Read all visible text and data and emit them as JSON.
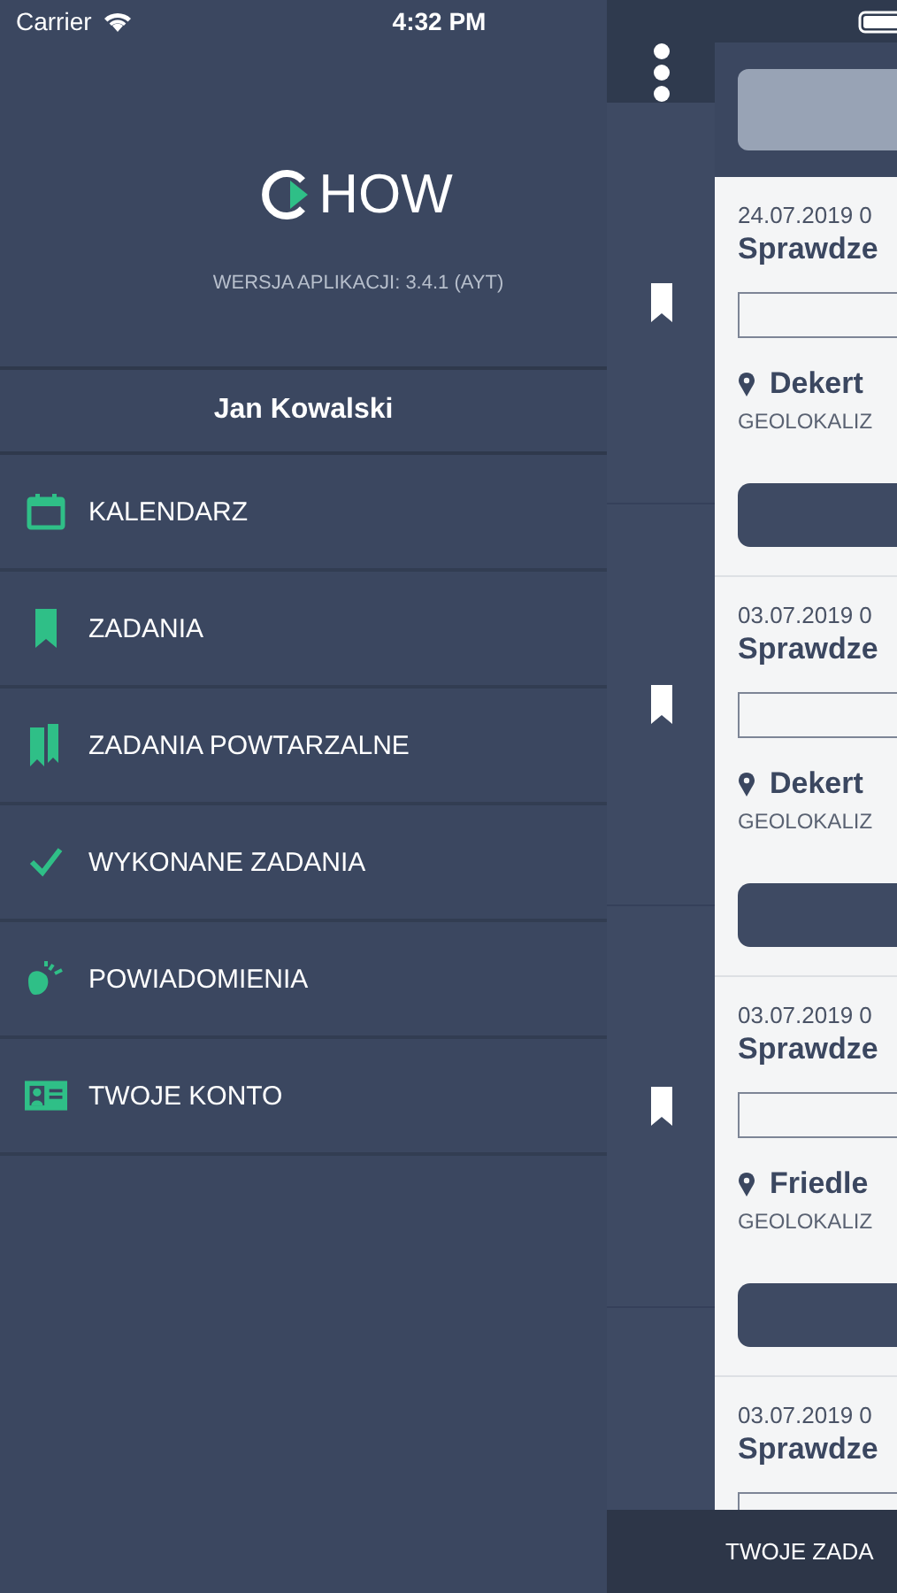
{
  "status_bar": {
    "carrier": "Carrier",
    "time": "4:32 PM"
  },
  "drawer": {
    "logo": "HOW",
    "version": "WERSJA APLIKACJI: 3.4.1 (AYT)",
    "user": "Jan Kowalski",
    "items": [
      {
        "kind": "calendar",
        "label": "KALENDARZ"
      },
      {
        "kind": "bookmark",
        "label": "ZADANIA"
      },
      {
        "kind": "bookmarks",
        "label": "ZADANIA POWTARZALNE"
      },
      {
        "kind": "check",
        "label": "WYKONANE ZADANIA"
      },
      {
        "kind": "bell",
        "label": "POWIADOMIENIA"
      },
      {
        "kind": "card",
        "label": "TWOJE KONTO"
      }
    ]
  },
  "tasks": [
    {
      "date": "24.07.2019 0",
      "title": "Sprawdze",
      "location": "Dekert",
      "geo": "GEOLOKALIZ"
    },
    {
      "date": "03.07.2019 0",
      "title": "Sprawdze",
      "location": "Dekert",
      "geo": "GEOLOKALIZ"
    },
    {
      "date": "03.07.2019 0",
      "title": "Sprawdze",
      "location": "Friedle",
      "geo": "GEOLOKALIZ"
    },
    {
      "date": "03.07.2019 0",
      "title": "Sprawdze"
    }
  ],
  "bottom_bar": {
    "label": "TWOJE ZADA"
  }
}
